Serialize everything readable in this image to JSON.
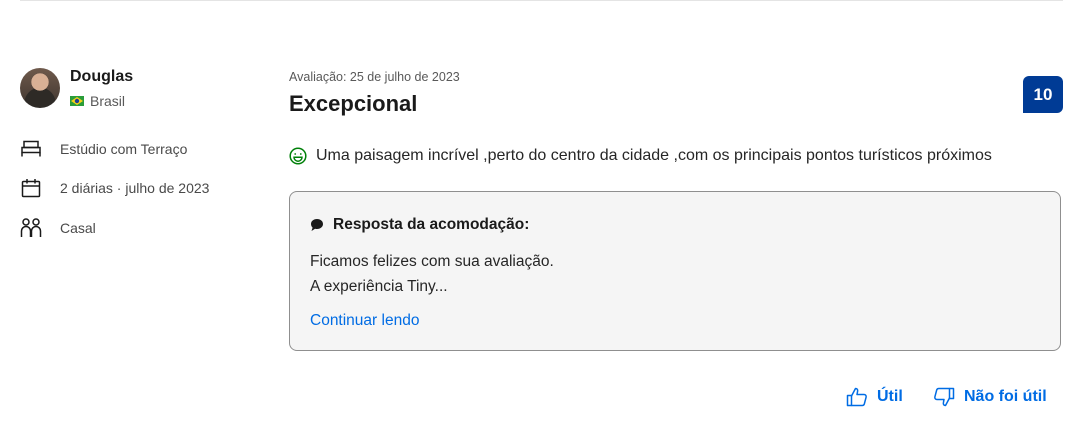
{
  "reviewer": {
    "name": "Douglas",
    "country": "Brasil",
    "room": "Estúdio com Terraço",
    "stay": "2 diárias · julho de 2023",
    "group": "Casal"
  },
  "review": {
    "date": "Avaliação: 25 de julho de 2023",
    "title": "Excepcional",
    "score": "10",
    "positive": "Uma paisagem incrível ,perto do centro da cidade ,com os principais pontos turísticos próximos"
  },
  "response": {
    "heading": "Resposta da acomodação:",
    "line1": "Ficamos felizes com sua avaliação.",
    "line2": "A experiência Tiny...",
    "continue_label": "Continuar lendo"
  },
  "votes": {
    "helpful_label": "Útil",
    "not_helpful_label": "Não foi útil"
  },
  "colors": {
    "accent_link": "#006ce4",
    "score_badge": "#003b95",
    "positive_icon": "#008009"
  },
  "icons": {
    "avatar": "avatar",
    "flag": "brazil-flag-icon",
    "room": "bed-icon",
    "stay": "calendar-icon",
    "group": "couple-icon",
    "positive": "smile-icon",
    "response": "speech-bubble-icon",
    "helpful": "thumbs-up-icon",
    "not_helpful": "thumbs-down-icon"
  }
}
